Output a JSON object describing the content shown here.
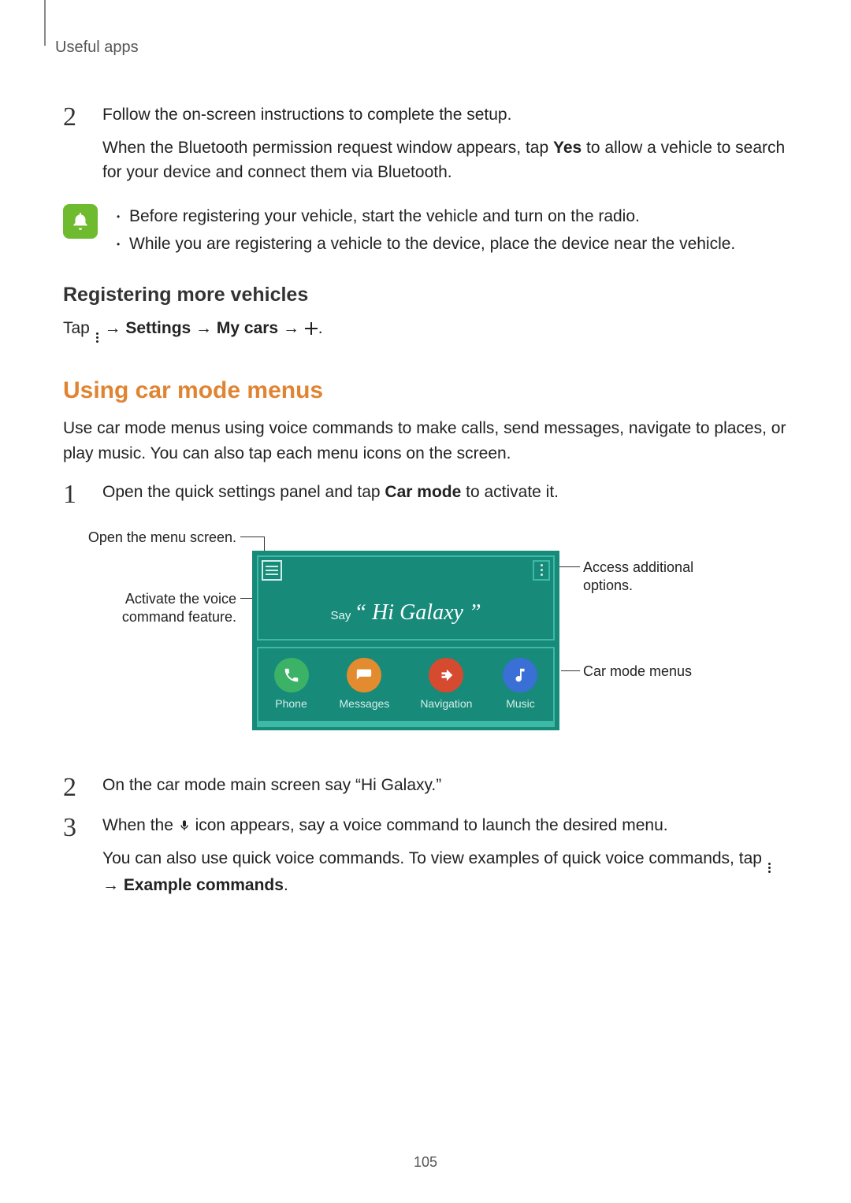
{
  "header": {
    "category": "Useful apps"
  },
  "step2a": {
    "p1": "Follow the on-screen instructions to complete the setup.",
    "p2a": "When the Bluetooth permission request window appears, tap ",
    "p2bold": "Yes",
    "p2b": " to allow a vehicle to search for your device and connect them via Bluetooth."
  },
  "note": {
    "b1": "Before registering your vehicle, start the vehicle and turn on the radio.",
    "b2": "While you are registering a vehicle to the device, place the device near the vehicle."
  },
  "reg": {
    "heading": "Registering more vehicles",
    "tap": "Tap ",
    "arrow1": " → ",
    "settings": "Settings",
    "arrow2": " → ",
    "mycars": "My cars",
    "arrow3": " → ",
    "period": "."
  },
  "carmode": {
    "heading": "Using car mode menus",
    "intro": "Use car mode menus using voice commands to make calls, send messages, navigate to places, or play music. You can also tap each menu icons on the screen."
  },
  "step1b": {
    "p1a": "Open the quick settings panel and tap ",
    "p1bold": "Car mode",
    "p1b": " to activate it."
  },
  "diagram": {
    "open_menu": "Open the menu screen.",
    "activate_voice": "Activate the voice command feature.",
    "access_options": "Access additional options.",
    "car_menus": "Car mode menus",
    "say_label": "Say",
    "say_phrase": "“ Hi Galaxy ”",
    "icons": {
      "phone": "Phone",
      "messages": "Messages",
      "navigation": "Navigation",
      "music": "Music"
    }
  },
  "step2b": {
    "p1": "On the car mode main screen say “Hi Galaxy.”"
  },
  "step3": {
    "p1a": "When the ",
    "p1b": " icon appears, say a voice command to launch the desired menu.",
    "p2": "You can also use quick voice commands. To view examples of quick voice commands, tap ",
    "arrow": " → ",
    "example": "Example commands",
    "period": "."
  },
  "pagenum": "105"
}
